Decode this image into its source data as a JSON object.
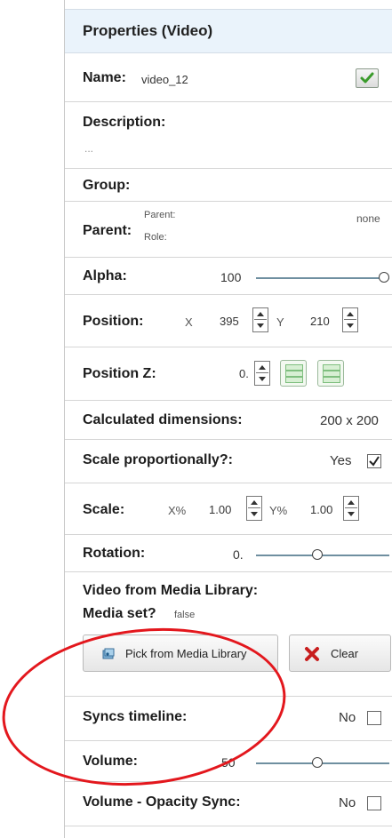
{
  "panel": {
    "title": "Properties (Video)"
  },
  "name": {
    "label": "Name:",
    "value": "video_12"
  },
  "description": {
    "label": "Description:",
    "value": "..."
  },
  "group": {
    "label": "Group:"
  },
  "parent": {
    "label": "Parent:",
    "sub_parent": "Parent:",
    "sub_role": "Role:",
    "value": "none"
  },
  "alpha": {
    "label": "Alpha:",
    "value": "100",
    "level": 1.0
  },
  "position": {
    "label": "Position:",
    "x_label": "X",
    "x_value": "395",
    "y_label": "Y",
    "y_value": "210"
  },
  "position_z": {
    "label": "Position Z:",
    "value": "0."
  },
  "calculated_dimensions": {
    "label": "Calculated dimensions:",
    "value": "200 x 200"
  },
  "scale_proportionally": {
    "label": "Scale proportionally?:",
    "value": "Yes",
    "checked": true
  },
  "scale": {
    "label": "Scale:",
    "x_label": "X%",
    "x_value": "1.00",
    "y_label": "Y%",
    "y_value": "1.00"
  },
  "rotation": {
    "label": "Rotation:",
    "value": "0.",
    "level": 0.5
  },
  "video_media": {
    "label": "Video from Media Library:",
    "media_set_label": "Media set?",
    "media_set_value": "false",
    "pick_button": "Pick from Media Library",
    "clear_button": "Clear"
  },
  "syncs_timeline": {
    "label": "Syncs timeline:",
    "value": "No",
    "checked": false
  },
  "volume": {
    "label": "Volume:",
    "value": "50",
    "level": 0.5
  },
  "volume_opacity_sync": {
    "label": "Volume - Opacity Sync:",
    "value": "No",
    "checked": false
  },
  "colors": {
    "header_bg": "#eaf3fb",
    "annotation": "#e3171d",
    "check_green": "#3a9b2b",
    "clear_red": "#c81e1e"
  },
  "icons": [
    "checkmark-icon",
    "stepper-icon",
    "align-top-icon",
    "align-bottom-icon",
    "media-library-icon",
    "clear-x-icon"
  ]
}
